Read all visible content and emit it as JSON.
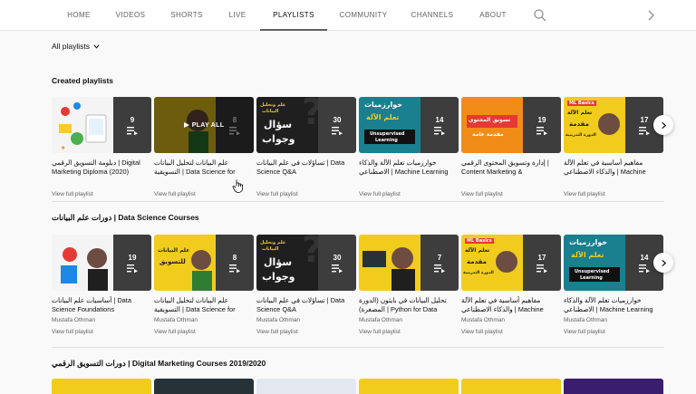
{
  "tabs": [
    "HOME",
    "VIDEOS",
    "SHORTS",
    "LIVE",
    "PLAYLISTS",
    "COMMUNITY",
    "CHANNELS",
    "ABOUT"
  ],
  "active_tab": "PLAYLISTS",
  "sort_label": "All playlists",
  "view_full_playlist": "View full playlist",
  "play_all": "PLAY ALL",
  "sections": [
    {
      "title": "Created playlists",
      "cards": [
        {
          "count": "9",
          "title": "دبلومة التسويق الرقمي | Digital Marketing Diploma (2020)",
          "author": ""
        },
        {
          "count": "8",
          "title": "علم البيانات لتحليل البيانات التسويقية | Data Science for Marketing Analytics",
          "author": ""
        },
        {
          "count": "30",
          "title": "تساؤلات في علم البيانات | Data Science Q&A",
          "author": "",
          "art": [
            "علم وتحليل",
            "البيانات",
            "سؤال",
            "وجواب"
          ]
        },
        {
          "count": "14",
          "title": "خوارزميات تعلم الآلة والذكاء الاصطناعي | Machine Learning Algorithms",
          "author": "",
          "art": [
            "خوارزميات",
            "تعلم الآلة",
            "Unsupervised",
            "Learning"
          ]
        },
        {
          "count": "19",
          "title": "إدارة وتسويق المحتوى الرقمي | Content Marketing & Management",
          "author": "",
          "art": [
            "تسويق المحتوى",
            "مقدمة عامة"
          ]
        },
        {
          "count": "17",
          "title": "مفاهيم أساسية في تعلم الآلة والذكاء الاصطناعي | Machine Learning & Artificial...",
          "author": "",
          "art": [
            "ML Basics",
            "تعلم الآلة",
            "مقدمة",
            "الدورة التدريبية"
          ]
        }
      ]
    },
    {
      "title": "دورات علم البيانات | Data Science Courses",
      "cards": [
        {
          "count": "19",
          "title": "أساسيات علم البيانات | Data Science Foundations",
          "author": "Mustafa Othman"
        },
        {
          "count": "8",
          "title": "علم البيانات لتحليل البيانات التسويقية | Data Science for Marketing Analytics",
          "author": "Mustafa Othman",
          "art": [
            "علم البيانات",
            "للتسويق"
          ]
        },
        {
          "count": "30",
          "title": "تساؤلات في علم البيانات | Data Science Q&A",
          "author": "Mustafa Othman",
          "art": [
            "علم وتحليل",
            "البيانات",
            "سؤال",
            "وجواب"
          ]
        },
        {
          "count": "7",
          "title": "تحليل البيانات في بايثون (الدورة المصغرة) | Python for Data Analysis (Crash...",
          "author": "Mustafa Othman"
        },
        {
          "count": "17",
          "title": "مفاهيم أساسية في تعلم الآلة والذكاء الاصطناعي | Machine Learning & Artificial...",
          "author": "Mustafa Othman",
          "art": [
            "ML Basics",
            "تعلم الآلة",
            "مقدمة",
            "الدورة التدريبية"
          ]
        },
        {
          "count": "14",
          "title": "خوارزميات تعلم الآلة والذكاء الاصطناعي | Machine Learning Algorithms",
          "author": "Mustafa Othman",
          "art": [
            "خوارزميات",
            "تعلم الآلة",
            "Unsupervised",
            "Learning"
          ]
        }
      ]
    },
    {
      "title": "دورات التسويق الرقمي | Digital Marketing Courses 2019/2020",
      "cards": []
    }
  ],
  "colors": {
    "yellow": "#f2cc1d",
    "teal": "#1a7f8e",
    "orange": "#f28c18",
    "dark": "#1f1f1f",
    "overlay": "#141414",
    "accent_red": "#e53935"
  }
}
